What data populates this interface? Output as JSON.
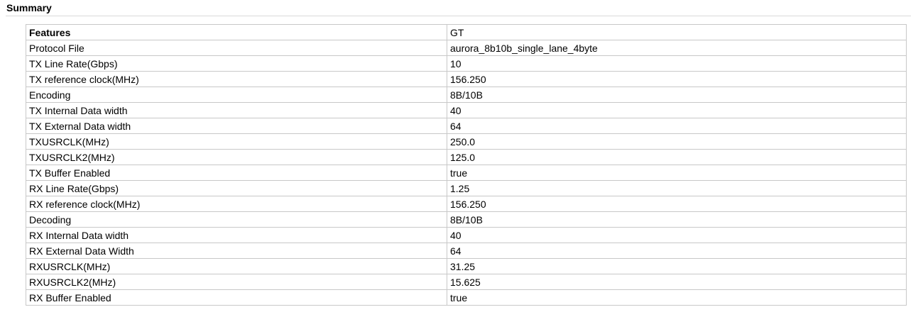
{
  "section": {
    "title": "Summary"
  },
  "table": {
    "header": {
      "feature": "Features",
      "value": "GT"
    },
    "rows": [
      {
        "feature": "Protocol File",
        "value": "aurora_8b10b_single_lane_4byte"
      },
      {
        "feature": "TX Line Rate(Gbps)",
        "value": "10"
      },
      {
        "feature": "TX reference clock(MHz)",
        "value": "156.250"
      },
      {
        "feature": "Encoding",
        "value": "8B/10B"
      },
      {
        "feature": "TX Internal Data width",
        "value": "40"
      },
      {
        "feature": "TX External Data width",
        "value": "64"
      },
      {
        "feature": "TXUSRCLK(MHz)",
        "value": "250.0"
      },
      {
        "feature": "TXUSRCLK2(MHz)",
        "value": "125.0"
      },
      {
        "feature": "TX Buffer Enabled",
        "value": "true"
      },
      {
        "feature": "RX Line Rate(Gbps)",
        "value": "1.25"
      },
      {
        "feature": "RX reference clock(MHz)",
        "value": "156.250"
      },
      {
        "feature": "Decoding",
        "value": "8B/10B"
      },
      {
        "feature": "RX Internal Data width",
        "value": "40"
      },
      {
        "feature": "RX External Data Width",
        "value": "64"
      },
      {
        "feature": "RXUSRCLK(MHz)",
        "value": "31.25"
      },
      {
        "feature": "RXUSRCLK2(MHz)",
        "value": "15.625"
      },
      {
        "feature": "RX Buffer Enabled",
        "value": "true"
      }
    ]
  }
}
